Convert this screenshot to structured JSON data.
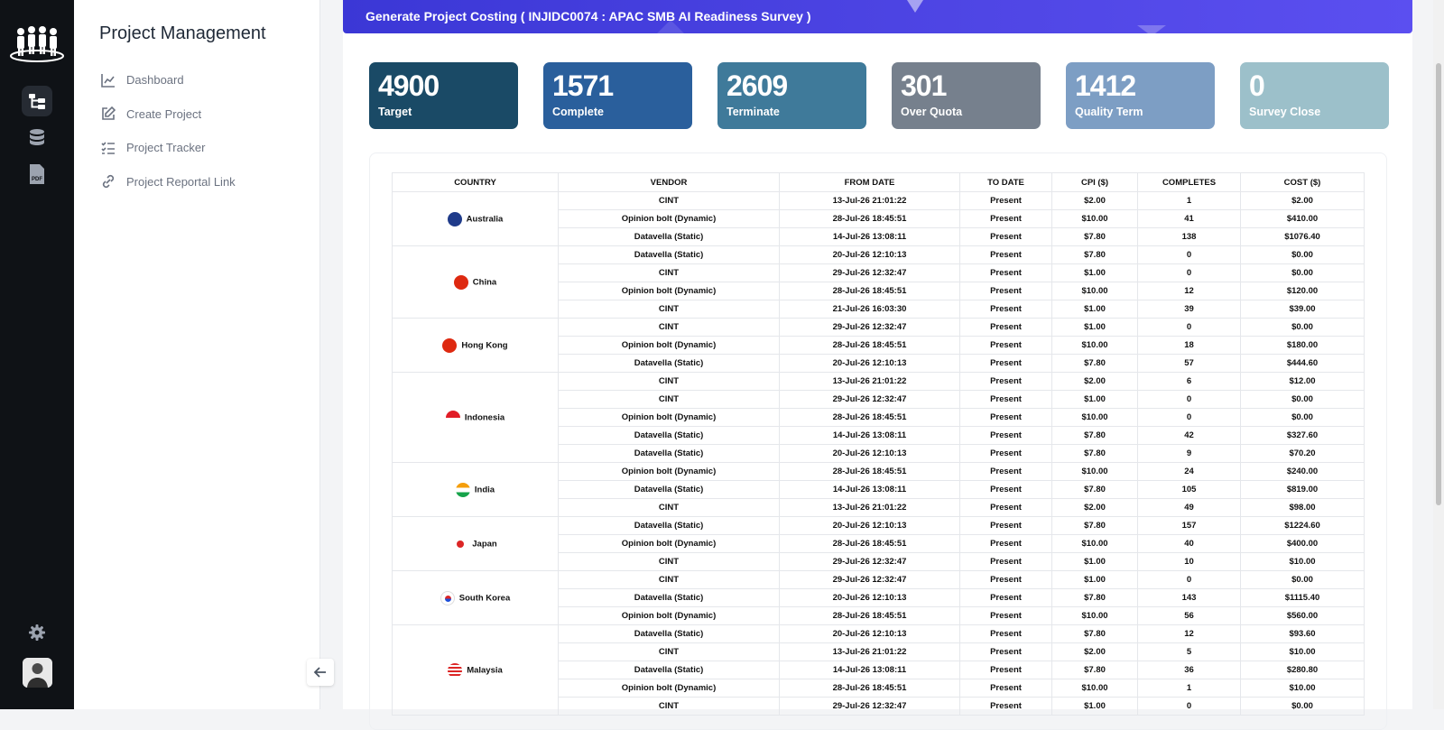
{
  "app": {
    "title": "Project Management"
  },
  "nav": [
    {
      "label": "Dashboard",
      "icon": "chart-icon"
    },
    {
      "label": "Create Project",
      "icon": "edit-icon"
    },
    {
      "label": "Project Tracker",
      "icon": "checklist-icon"
    },
    {
      "label": "Project Reportal Link",
      "icon": "link-icon"
    }
  ],
  "banner": {
    "title": "Generate Project Costing ( INJIDC0074 : APAC SMB AI Readiness Survey )"
  },
  "cards": [
    {
      "value": "4900",
      "label": "Target",
      "color": "#1a4a66"
    },
    {
      "value": "1571",
      "label": "Complete",
      "color": "#2a5f9c"
    },
    {
      "value": "2609",
      "label": "Terminate",
      "color": "#3f7a9a"
    },
    {
      "value": "301",
      "label": "Over Quota",
      "color": "#76808d"
    },
    {
      "value": "1412",
      "label": "Quality Term",
      "color": "#7d9ec4"
    },
    {
      "value": "0",
      "label": "Survey Close",
      "color": "#9cc0ca"
    }
  ],
  "table": {
    "headers": [
      "COUNTRY",
      "VENDOR",
      "FROM DATE",
      "TO DATE",
      "CPI ($)",
      "COMPLETES",
      "COST ($)"
    ],
    "groups": [
      {
        "country": "Australia",
        "flag": "australia",
        "rows": [
          [
            "CINT",
            "13-Jul-26 21:01:22",
            "Present",
            "$2.00",
            "1",
            "$2.00"
          ],
          [
            "Opinion bolt (Dynamic)",
            "28-Jul-26 18:45:51",
            "Present",
            "$10.00",
            "41",
            "$410.00"
          ],
          [
            "Datavella (Static)",
            "14-Jul-26 13:08:11",
            "Present",
            "$7.80",
            "138",
            "$1076.40"
          ]
        ]
      },
      {
        "country": "China",
        "flag": "china",
        "rows": [
          [
            "Datavella (Static)",
            "20-Jul-26 12:10:13",
            "Present",
            "$7.80",
            "0",
            "$0.00"
          ],
          [
            "CINT",
            "29-Jul-26 12:32:47",
            "Present",
            "$1.00",
            "0",
            "$0.00"
          ],
          [
            "Opinion bolt (Dynamic)",
            "28-Jul-26 18:45:51",
            "Present",
            "$10.00",
            "12",
            "$120.00"
          ],
          [
            "CINT",
            "21-Jul-26 16:03:30",
            "Present",
            "$1.00",
            "39",
            "$39.00"
          ]
        ]
      },
      {
        "country": "Hong Kong",
        "flag": "hongkong",
        "rows": [
          [
            "CINT",
            "29-Jul-26 12:32:47",
            "Present",
            "$1.00",
            "0",
            "$0.00"
          ],
          [
            "Opinion bolt (Dynamic)",
            "28-Jul-26 18:45:51",
            "Present",
            "$10.00",
            "18",
            "$180.00"
          ],
          [
            "Datavella (Static)",
            "20-Jul-26 12:10:13",
            "Present",
            "$7.80",
            "57",
            "$444.60"
          ]
        ]
      },
      {
        "country": "Indonesia",
        "flag": "indonesia",
        "rows": [
          [
            "CINT",
            "13-Jul-26 21:01:22",
            "Present",
            "$2.00",
            "6",
            "$12.00"
          ],
          [
            "CINT",
            "29-Jul-26 12:32:47",
            "Present",
            "$1.00",
            "0",
            "$0.00"
          ],
          [
            "Opinion bolt (Dynamic)",
            "28-Jul-26 18:45:51",
            "Present",
            "$10.00",
            "0",
            "$0.00"
          ],
          [
            "Datavella (Static)",
            "14-Jul-26 13:08:11",
            "Present",
            "$7.80",
            "42",
            "$327.60"
          ],
          [
            "Datavella (Static)",
            "20-Jul-26 12:10:13",
            "Present",
            "$7.80",
            "9",
            "$70.20"
          ]
        ]
      },
      {
        "country": "India",
        "flag": "india",
        "rows": [
          [
            "Opinion bolt (Dynamic)",
            "28-Jul-26 18:45:51",
            "Present",
            "$10.00",
            "24",
            "$240.00"
          ],
          [
            "Datavella (Static)",
            "14-Jul-26 13:08:11",
            "Present",
            "$7.80",
            "105",
            "$819.00"
          ],
          [
            "CINT",
            "13-Jul-26 21:01:22",
            "Present",
            "$2.00",
            "49",
            "$98.00"
          ]
        ]
      },
      {
        "country": "Japan",
        "flag": "japan",
        "rows": [
          [
            "Datavella (Static)",
            "20-Jul-26 12:10:13",
            "Present",
            "$7.80",
            "157",
            "$1224.60"
          ],
          [
            "Opinion bolt (Dynamic)",
            "28-Jul-26 18:45:51",
            "Present",
            "$10.00",
            "40",
            "$400.00"
          ],
          [
            "CINT",
            "29-Jul-26 12:32:47",
            "Present",
            "$1.00",
            "10",
            "$10.00"
          ]
        ]
      },
      {
        "country": "South Korea",
        "flag": "southkorea",
        "rows": [
          [
            "CINT",
            "29-Jul-26 12:32:47",
            "Present",
            "$1.00",
            "0",
            "$0.00"
          ],
          [
            "Datavella (Static)",
            "20-Jul-26 12:10:13",
            "Present",
            "$7.80",
            "143",
            "$1115.40"
          ],
          [
            "Opinion bolt (Dynamic)",
            "28-Jul-26 18:45:51",
            "Present",
            "$10.00",
            "56",
            "$560.00"
          ]
        ]
      },
      {
        "country": "Malaysia",
        "flag": "malaysia",
        "rows": [
          [
            "Datavella (Static)",
            "20-Jul-26 12:10:13",
            "Present",
            "$7.80",
            "12",
            "$93.60"
          ],
          [
            "CINT",
            "13-Jul-26 21:01:22",
            "Present",
            "$2.00",
            "5",
            "$10.00"
          ],
          [
            "Datavella (Static)",
            "14-Jul-26 13:08:11",
            "Present",
            "$7.80",
            "36",
            "$280.80"
          ],
          [
            "Opinion bolt (Dynamic)",
            "28-Jul-26 18:45:51",
            "Present",
            "$10.00",
            "1",
            "$10.00"
          ],
          [
            "CINT",
            "29-Jul-26 12:32:47",
            "Present",
            "$1.00",
            "0",
            "$0.00"
          ]
        ]
      }
    ]
  }
}
